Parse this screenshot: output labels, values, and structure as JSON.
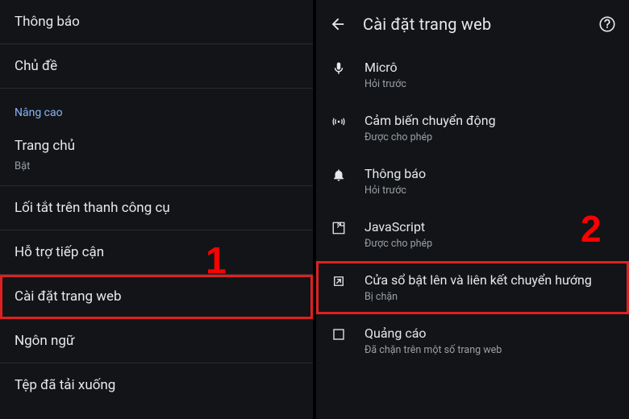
{
  "callouts": {
    "n1": "1",
    "n2": "2"
  },
  "left": {
    "rows": {
      "notifications": "Thông báo",
      "theme": "Chủ đề",
      "advanced_header": "Nâng cao",
      "homepage": {
        "label": "Trang chủ",
        "status": "Bật"
      },
      "toolbar_shortcut": "Lối tắt trên thanh công cụ",
      "accessibility": "Hỗ trợ tiếp cận",
      "site_settings": "Cài đặt trang web",
      "language": "Ngôn ngữ",
      "downloads": "Tệp đã tải xuống"
    }
  },
  "right": {
    "header": {
      "title": "Cài đặt trang web"
    },
    "items": {
      "mic": {
        "label": "Micrô",
        "status": "Hỏi trước"
      },
      "motion": {
        "label": "Cảm biến chuyển động",
        "status": "Được cho phép"
      },
      "notif": {
        "label": "Thông báo",
        "status": "Hỏi trước"
      },
      "javascript": {
        "label": "JavaScript",
        "status": "Được cho phép"
      },
      "popups": {
        "label": "Cửa sổ bật lên và liên kết chuyển hướng",
        "status": "Bị chặn"
      },
      "ads": {
        "label": "Quảng cáo",
        "status": "Đã chặn trên một số trang web"
      }
    }
  }
}
